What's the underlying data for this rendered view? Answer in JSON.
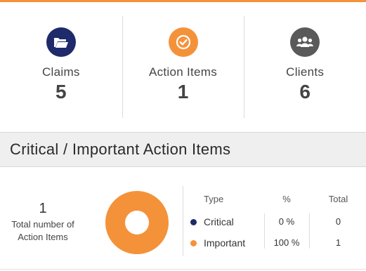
{
  "colors": {
    "accent": "#f4923a",
    "navy": "#1f2a6b",
    "gray_icon": "#5a5a5a"
  },
  "stats": [
    {
      "label": "Claims",
      "value": "5",
      "icon": "folder-open-icon"
    },
    {
      "label": "Action Items",
      "value": "1",
      "icon": "check-circle-icon"
    },
    {
      "label": "Clients",
      "value": "6",
      "icon": "users-icon"
    }
  ],
  "section": {
    "title": "Critical / Important Action Items"
  },
  "summary": {
    "total_value": "1",
    "total_label_line1": "Total number of",
    "total_label_line2": "Action Items"
  },
  "legend": {
    "headers": {
      "type": "Type",
      "pct": "%",
      "total": "Total"
    },
    "rows": [
      {
        "name": "Critical",
        "pct": "0 %",
        "total": "0",
        "color": "#1f2a6b"
      },
      {
        "name": "Important",
        "pct": "100 %",
        "total": "1",
        "color": "#f4923a"
      }
    ]
  },
  "chart_data": {
    "type": "pie",
    "categories": [
      "Critical",
      "Important"
    ],
    "values": [
      0,
      1
    ]
  }
}
